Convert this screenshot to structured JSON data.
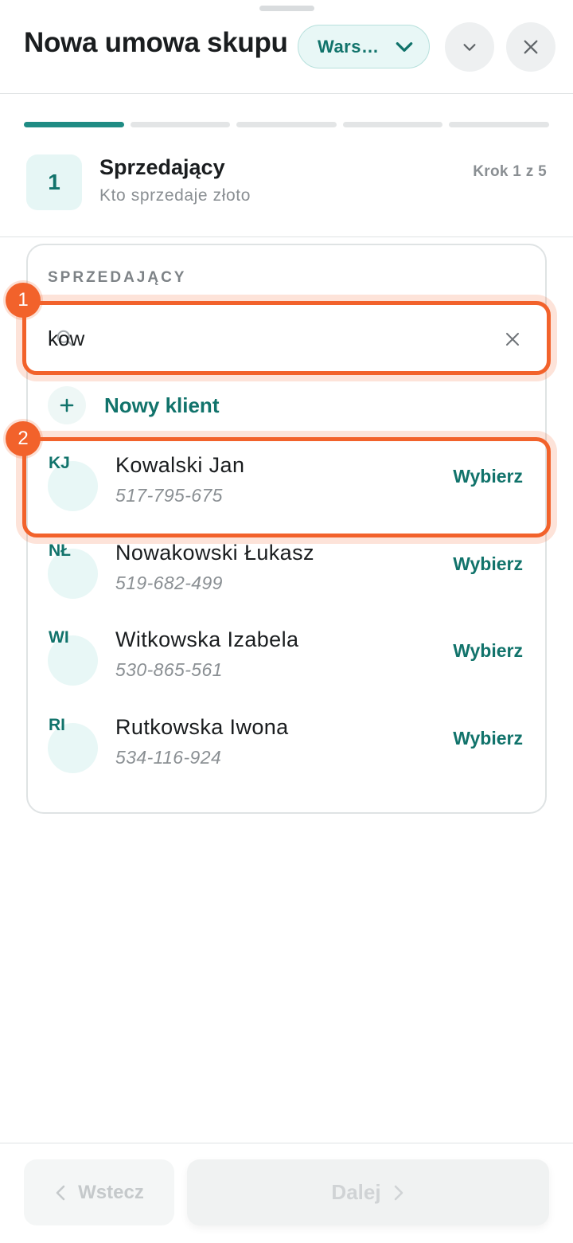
{
  "header": {
    "title": "Nowa umowa skupu",
    "branch": "Wars…",
    "icons": {
      "branch_chevron": "chevron-down-icon",
      "collapse": "chevron-down-icon",
      "close": "close-icon"
    }
  },
  "progress": {
    "total_steps": 5,
    "current_step": 1
  },
  "step": {
    "number": "1",
    "title": "Sprzedający",
    "subtitle": "Kto sprzedaje złoto",
    "counter": "Krok 1 z 5"
  },
  "seller_section": {
    "label": "SPRZEDAJĄCY",
    "search": {
      "value": "kow",
      "icon": "search-icon",
      "clear_icon": "close-icon"
    },
    "new_client": {
      "label": "Nowy klient",
      "icon": "plus-icon"
    },
    "clients": [
      {
        "initials": "KJ",
        "name": "Kowalski Jan",
        "phone": "517-795-675",
        "action": "Wybierz"
      },
      {
        "initials": "NŁ",
        "name": "Nowakowski Łukasz",
        "phone": "519-682-499",
        "action": "Wybierz"
      },
      {
        "initials": "WI",
        "name": "Witkowska Izabela",
        "phone": "530-865-561",
        "action": "Wybierz"
      },
      {
        "initials": "RI",
        "name": "Rutkowska Iwona",
        "phone": "534-116-924",
        "action": "Wybierz"
      }
    ]
  },
  "annotations": {
    "badge_1": "1",
    "badge_2": "2",
    "color": "#f2622b"
  },
  "footer": {
    "back_label": "Wstecz",
    "next_label": "Dalej"
  },
  "colors": {
    "accent": "#11736b",
    "progress_active": "#1f8c84",
    "highlight": "#f2622b"
  }
}
